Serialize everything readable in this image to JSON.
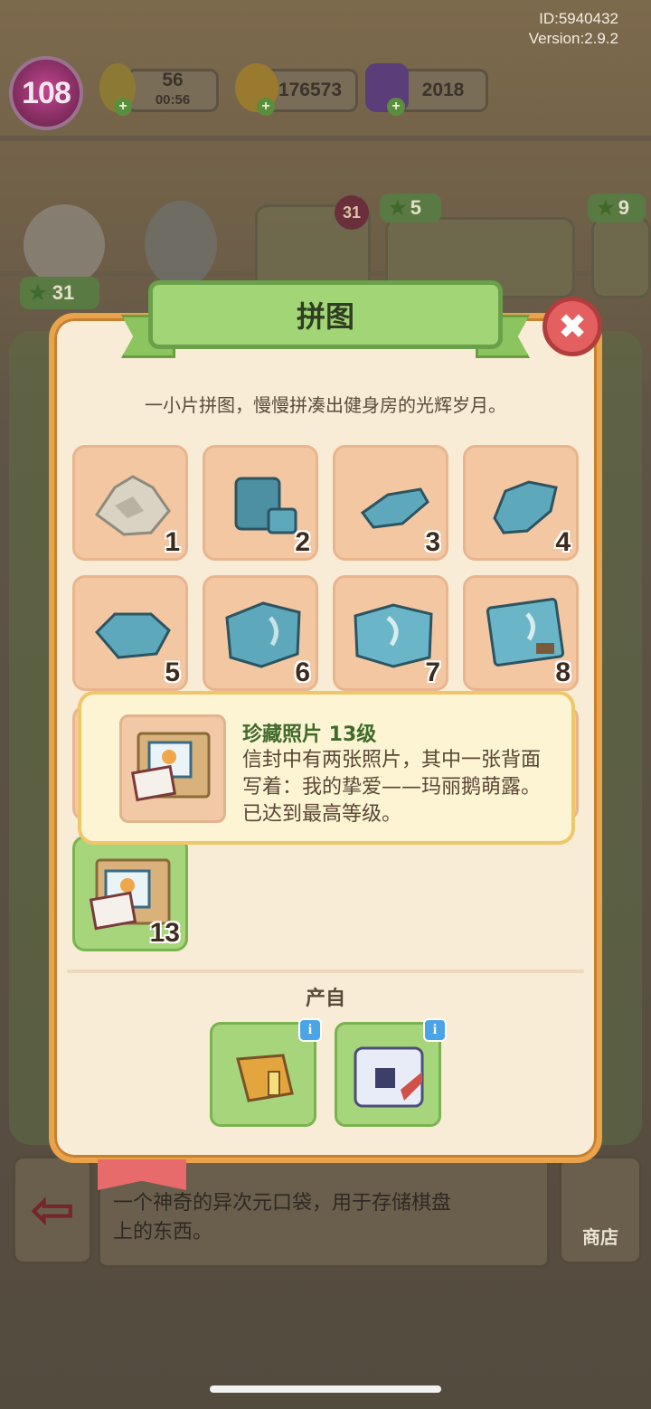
{
  "hud": {
    "id_text": "ID:5940432",
    "version_text": "Version:2.9.2",
    "level": "108",
    "energy": "56",
    "energy_timer": "00:56",
    "coins": "176573",
    "gems": "2018"
  },
  "background": {
    "badge_31": "31",
    "tag_5": "5",
    "tag_9": "9",
    "tag_31": "31",
    "storage_desc_line1": "一个神奇的异次元口袋，用于存储棋盘",
    "storage_desc_line2": "上的东西。",
    "exit_glyph": "⇦",
    "shop_label": "商店"
  },
  "dialog": {
    "title": "拼图",
    "close_glyph": "✖",
    "subtitle": "一小片拼图，慢慢拼凑出健身房的光辉岁月。",
    "tiles": [
      {
        "num": "1"
      },
      {
        "num": "2"
      },
      {
        "num": "3"
      },
      {
        "num": "4"
      },
      {
        "num": "5"
      },
      {
        "num": "6"
      },
      {
        "num": "7"
      },
      {
        "num": "8"
      },
      {
        "num": "13"
      }
    ],
    "tooltip": {
      "title": "珍藏照片 13级",
      "desc": "信封中有两张照片，其中一张背面写着：我的挚爱——玛丽鹅萌露。已达到最高等级。"
    },
    "source_label": "产自",
    "info_glyph": "i"
  },
  "colors": {
    "dialog_bg": "#f8ecd6",
    "dialog_border": "#e9a34a",
    "ribbon_green": "#a2d576",
    "tile_peach": "#f4c7a3",
    "tile_green": "#a7d57c",
    "close_red": "#e46060"
  },
  "icons": {
    "level": "level-badge-icon",
    "energy": "lightning-icon",
    "coin": "coin-icon",
    "gem": "gem-icon",
    "close": "close-icon",
    "info": "info-icon"
  }
}
